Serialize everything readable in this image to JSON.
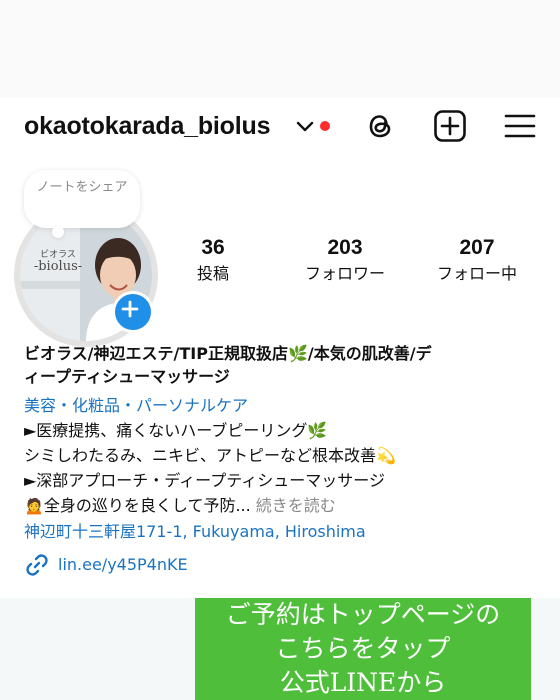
{
  "profile": {
    "username": "okaotokarada_biolus",
    "avatar_sign_top": "ビオラス",
    "avatar_sign_main": "-biolus-"
  },
  "note": {
    "text": "ノートをシェア"
  },
  "stats": [
    {
      "value": "36",
      "label": "投稿"
    },
    {
      "value": "203",
      "label": "フォロワー"
    },
    {
      "value": "207",
      "label": "フォロー中"
    }
  ],
  "bio": {
    "name_line1": "ビオラス/神辺エステ/TIP正規取扱店🌿/本気の肌改善/デ",
    "name_line2": "ィープティシューマッサージ",
    "category": "美容・化粧品・パーソナルケア",
    "line1": "►医療提携、痛くないハーブピーリング🌿",
    "line2": "シミしわたるみ、ニキビ、アトピーなど根本改善💫",
    "line3": "►深部アプローチ・ディープティシューマッサージ",
    "line4": "🙍全身の巡りを良くして予防...",
    "read_more": "続きを読む",
    "address": "神辺町十三軒屋171-1, Fukuyama, Hiroshima",
    "link": "lin.ee/y45P4nKE"
  },
  "banner": {
    "line1": "ご予約はトップページの",
    "line2": "こちらをタップ",
    "line3": "公式LINEから"
  },
  "colors": {
    "link_blue": "#1a73c2",
    "badge_blue": "#1f8fe8",
    "notification_red": "#ff2d2d",
    "banner_green": "#4fbf3b"
  },
  "icons": [
    "chevron-down-icon",
    "threads-icon",
    "add-post-icon",
    "menu-icon",
    "plus-icon",
    "link-icon"
  ]
}
